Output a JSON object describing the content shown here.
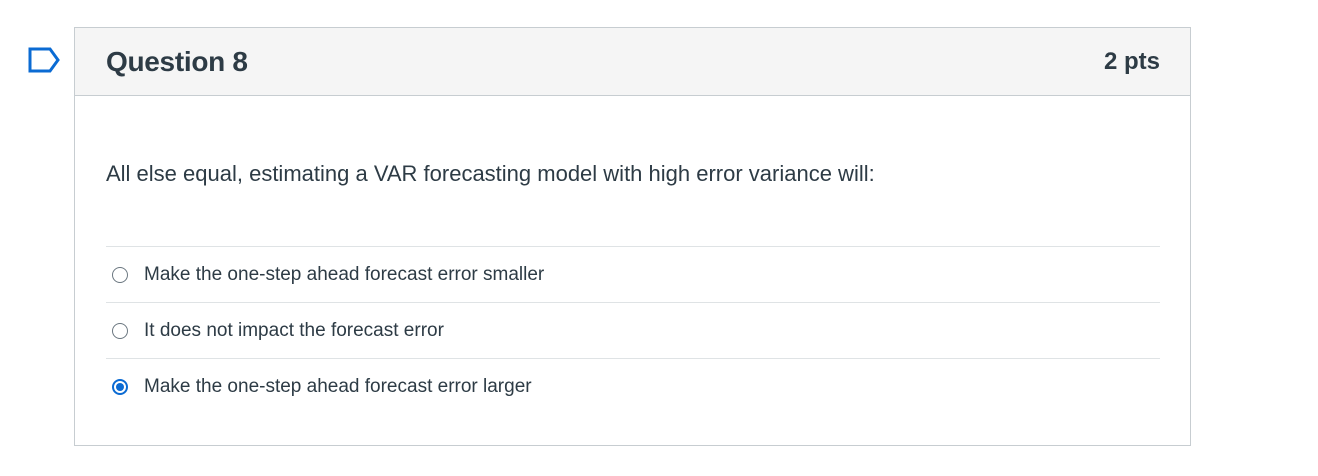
{
  "question": {
    "title": "Question 8",
    "points": "2 pts",
    "text": "All else equal, estimating a VAR forecasting model with high error variance will:",
    "flag_icon": "flag-outline-icon",
    "answers": [
      {
        "label": "Make the one-step ahead forecast error smaller",
        "selected": false
      },
      {
        "label": "It does not impact the forecast error",
        "selected": false
      },
      {
        "label": "Make the one-step ahead forecast error larger",
        "selected": true
      }
    ]
  },
  "colors": {
    "accent": "#0b6bd3",
    "flag": "#0b6bd3",
    "text": "#2d3b45",
    "header_bg": "#f5f5f5",
    "border": "#c7cdd1"
  }
}
